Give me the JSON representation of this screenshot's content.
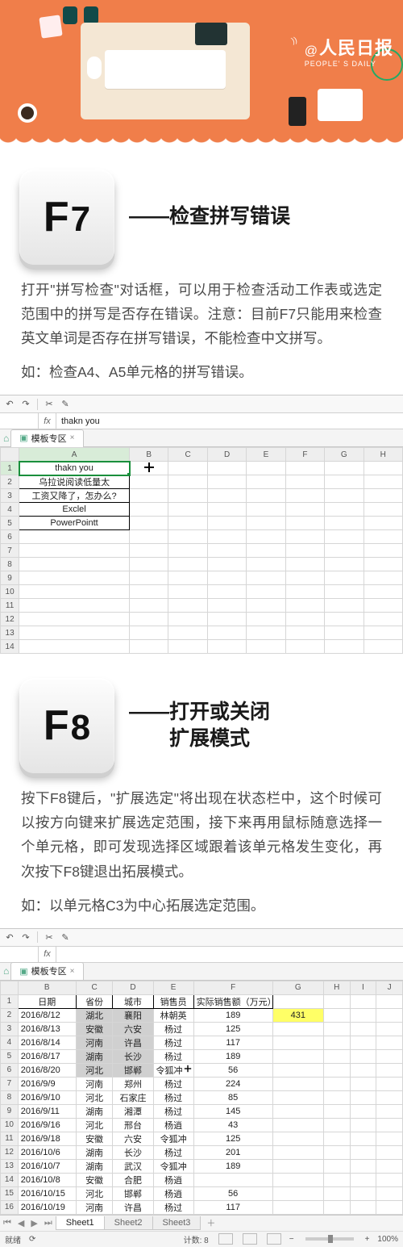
{
  "brand": {
    "cn": "人民日报",
    "en": "PEOPLE' S DAILY",
    "at": "@"
  },
  "f7": {
    "key_letter": "F",
    "key_digit": "7",
    "title": "——检查拼写错误",
    "desc": "打开\"拼写检查\"对话框，可以用于检查活动工作表或选定范围中的拼写是否存在错误。注意：目前F7只能用来检查英文单词是否存在拼写错误，不能检查中文拼写。",
    "eg": "如：检查A4、A5单元格的拼写错误。"
  },
  "f8": {
    "key_letter": "F",
    "key_digit": "8",
    "title_l1": "——打开或关闭",
    "title_l2": "扩展模式",
    "desc": "按下F8键后，\"扩展选定\"将出现在状态栏中，这个时候可以按方向键来扩展选定范围，接下来再用鼠标随意选择一个单元格，即可发现选择区域跟着该单元格发生变化，再次按下F8键退出拓展模式。",
    "eg": "如：以单元格C3为中心拓展选定范围。"
  },
  "ss1": {
    "namebox": "",
    "fx_label": "fx",
    "formula": "thakn you",
    "tab": "模板专区",
    "cols": [
      "A",
      "B",
      "C",
      "D",
      "E",
      "F",
      "G",
      "H"
    ],
    "col_a": [
      "thakn you",
      "乌拉说阅读低量太",
      "工资又降了，怎办么?",
      "Exclel",
      "PowerPointt"
    ],
    "rows": 14
  },
  "ss2": {
    "namebox": "",
    "fx_label": "fx",
    "formula": "",
    "tab": "模板专区",
    "cols": [
      "B",
      "C",
      "D",
      "E",
      "F",
      "G",
      "H",
      "I",
      "J"
    ],
    "header": [
      "日期",
      "省份",
      "城市",
      "销售员",
      "实际销售额（万元）"
    ],
    "g2_value": "431",
    "rows": [
      [
        "2016/8/12",
        "湖北",
        "襄阳",
        "林朝英",
        "189"
      ],
      [
        "2016/8/13",
        "安徽",
        "六安",
        "杨过",
        "125"
      ],
      [
        "2016/8/14",
        "河南",
        "许昌",
        "杨过",
        "117"
      ],
      [
        "2016/8/17",
        "湖南",
        "长沙",
        "杨过",
        "189"
      ],
      [
        "2016/8/20",
        "河北",
        "邯郸",
        "令狐冲",
        "56"
      ],
      [
        "2016/9/9",
        "河南",
        "郑州",
        "杨过",
        "224"
      ],
      [
        "2016/9/10",
        "河北",
        "石家庄",
        "杨过",
        "85"
      ],
      [
        "2016/9/11",
        "湖南",
        "湘潭",
        "杨过",
        "145"
      ],
      [
        "2016/9/16",
        "河北",
        "邢台",
        "杨逍",
        "43"
      ],
      [
        "2016/9/18",
        "安徽",
        "六安",
        "令狐冲",
        "125"
      ],
      [
        "2016/10/6",
        "湖南",
        "长沙",
        "杨过",
        "201"
      ],
      [
        "2016/10/7",
        "湖南",
        "武汉",
        "令狐冲",
        "189"
      ],
      [
        "2016/10/8",
        "安徽",
        "合肥",
        "杨逍",
        ""
      ],
      [
        "2016/10/15",
        "河北",
        "邯郸",
        "杨逍",
        "56"
      ],
      [
        "2016/10/19",
        "河南",
        "许昌",
        "杨过",
        "117"
      ]
    ],
    "sheets": [
      "Sheet1",
      "Sheet2",
      "Sheet3"
    ],
    "status_mode": "就绪",
    "status_count_label": "计数:",
    "status_count": "8",
    "zoom": "100%"
  }
}
